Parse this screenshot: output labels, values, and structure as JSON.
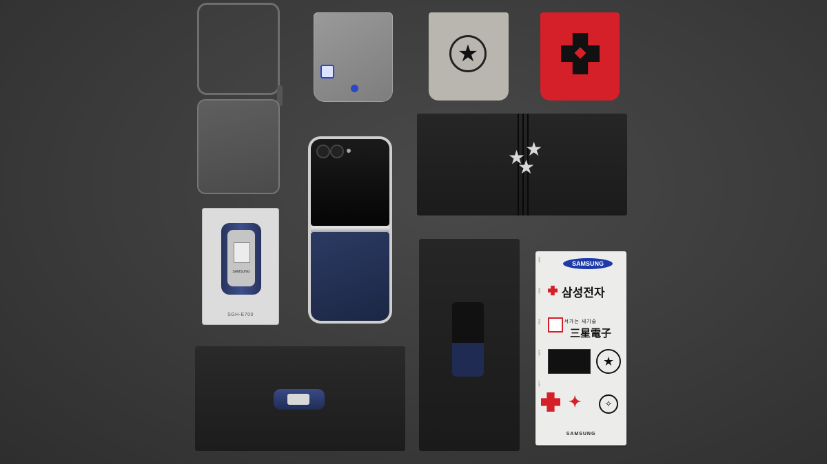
{
  "retro_card": {
    "brand": "SAMSUNG",
    "model": "SGH-E700"
  },
  "sticker_sheet": {
    "years": [
      "1969",
      "1993",
      "1969",
      "1976",
      "1977"
    ],
    "badge": "SAMSUNG",
    "korean_name": "삼성전자",
    "slogan": "앞서가는 새기술",
    "hanja_name": "三星電子",
    "footer": "SAMSUNG"
  },
  "colors": {
    "background": "#3b3b3b",
    "navy": "#1f2b52",
    "red": "#d5202a",
    "samsung_blue": "#1c3aa8"
  },
  "icons": [
    "star-emblem-icon",
    "red-cross-emblem-icon",
    "tri-star-icon",
    "camera-lens-icon"
  ]
}
